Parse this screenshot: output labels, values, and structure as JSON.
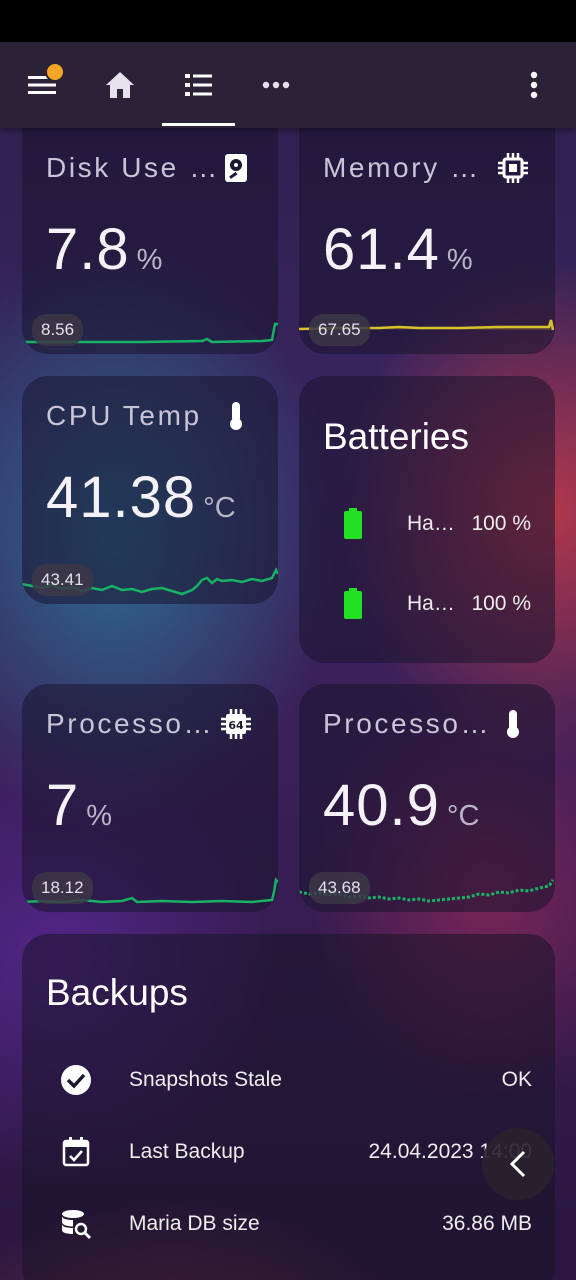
{
  "toolbar": {
    "menu_icon": "menu-icon",
    "home_icon": "home-icon",
    "list_icon": "format-list-icon",
    "more_horiz_icon": "dots-horizontal-icon",
    "more_vert_icon": "dots-vertical-icon",
    "badge_color": "#f5a623"
  },
  "cards": {
    "disk": {
      "title": "Disk Use …",
      "value": "7.8",
      "unit": "%",
      "min_label": "8.56",
      "icon": "harddisk-icon",
      "color": "#16b364"
    },
    "memory": {
      "title": "Memory …",
      "value": "61.4",
      "unit": "%",
      "min_label": "67.65",
      "icon": "memory-chip-icon",
      "color": "#d8c22a"
    },
    "cpu_temp": {
      "title": "CPU Temp",
      "value": "41.38",
      "unit": "°C",
      "min_label": "43.41",
      "icon": "thermometer-icon",
      "color": "#16b364"
    },
    "proc_load": {
      "title": "Processo…",
      "value": "7",
      "unit": "%",
      "min_label": "18.12",
      "icon": "cpu-64-bit-icon",
      "color": "#16b364"
    },
    "proc_temp": {
      "title": "Processo…",
      "value": "40.9",
      "unit": "°C",
      "min_label": "43.68",
      "icon": "thermometer-icon",
      "color": "#16b364"
    }
  },
  "batteries": {
    "title": "Batteries",
    "items": [
      {
        "name": "Ha…",
        "value": "100 %",
        "icon": "battery-full-icon"
      },
      {
        "name": "Ha…",
        "value": "100 %",
        "icon": "battery-full-icon"
      }
    ],
    "color": "#22e022"
  },
  "backups": {
    "title": "Backups",
    "rows": [
      {
        "icon": "check-circle-icon",
        "label": "Snapshots Stale",
        "value": "OK"
      },
      {
        "icon": "calendar-check-icon",
        "label": "Last Backup",
        "value": "24.04.2023 14:00"
      },
      {
        "icon": "database-search-icon",
        "label": "Maria DB size",
        "value": "36.86 MB"
      }
    ]
  },
  "fab": {
    "icon": "chevron-left-icon"
  }
}
